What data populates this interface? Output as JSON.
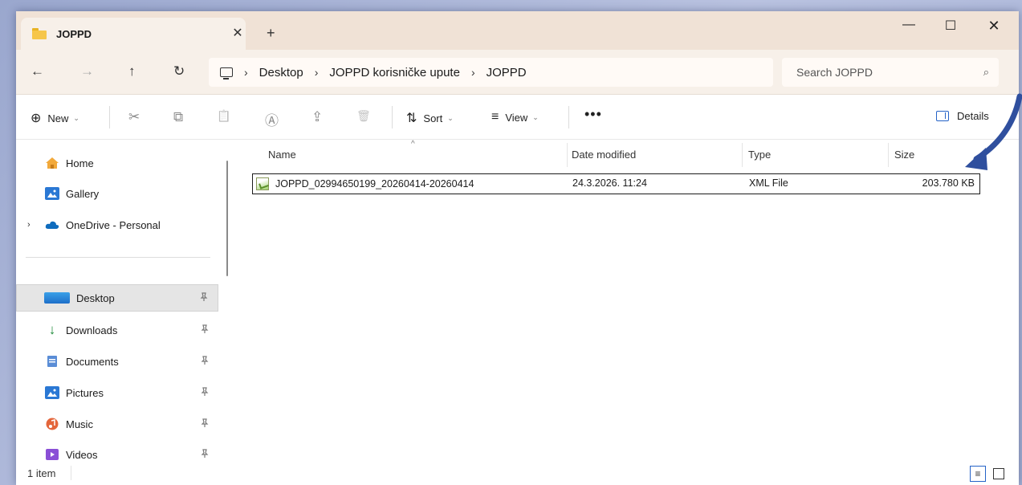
{
  "window": {
    "tab_title": "JOPPD",
    "tab_close": "✕",
    "new_tab": "+",
    "minimize": "—",
    "maximize": "☐",
    "close": "✕"
  },
  "address": {
    "back": "←",
    "forward": "→",
    "up": "↑",
    "refresh": "↻",
    "separator": "›",
    "breadcrumb": [
      "Desktop",
      "JOPPD korisničke upute",
      "JOPPD"
    ],
    "search_placeholder": "Search JOPPD",
    "search_icon": "⌕"
  },
  "toolbar": {
    "new_label": "New",
    "sort_label": "Sort",
    "view_label": "View",
    "more_label": "•••",
    "details_label": "Details",
    "caret": "⌄",
    "icons": {
      "new": "⊕",
      "cut": "✂",
      "copy": "⧉",
      "paste": "📋",
      "rename": "Ⓐ",
      "share": "⇪",
      "delete": "🗑",
      "sort": "⇅",
      "view": "≡"
    }
  },
  "sidebar": {
    "expand": "›",
    "pin": "📌",
    "items": [
      {
        "label": "Home",
        "icon": "home-icon"
      },
      {
        "label": "Gallery",
        "icon": "gallery-icon"
      },
      {
        "label": "OneDrive - Personal",
        "icon": "onedrive-icon"
      },
      {
        "label": "Desktop",
        "icon": "desktop-icon",
        "selected": true
      },
      {
        "label": "Downloads",
        "icon": "downloads-icon"
      },
      {
        "label": "Documents",
        "icon": "documents-icon"
      },
      {
        "label": "Pictures",
        "icon": "pictures-icon"
      },
      {
        "label": "Music",
        "icon": "music-icon"
      },
      {
        "label": "Videos",
        "icon": "videos-icon"
      }
    ]
  },
  "columns": {
    "name": "Name",
    "date": "Date modified",
    "type": "Type",
    "size": "Size",
    "sort_indicator": "^"
  },
  "files": [
    {
      "name": "JOPPD_02994650199_20260414-20260414",
      "date": "24.3.2026. 11:24",
      "type": "XML File",
      "size": "203.780 KB"
    }
  ],
  "status": {
    "item_count": "1 item",
    "details_view": "≡"
  },
  "colors": {
    "titlebar": "#f0e2d6",
    "accent": "#2563c7",
    "annotation_arrow": "#2f4f9e"
  }
}
